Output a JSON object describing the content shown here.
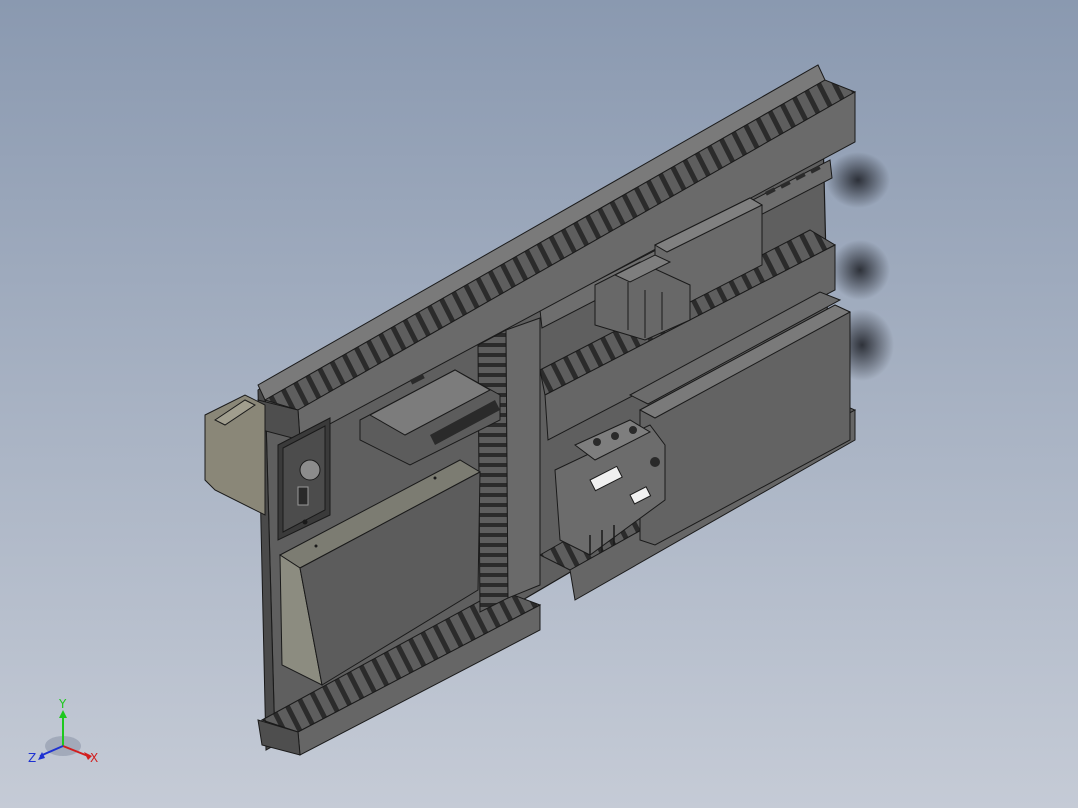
{
  "viewport": {
    "background_top": "#8a99b0",
    "background_bottom": "#c5cbd6"
  },
  "model": {
    "body_color": "#646464",
    "body_light": "#7a7a7a",
    "body_dark": "#4a4a4a",
    "edge_color": "#1a1a1a",
    "accent_white": "#f0f0f0",
    "transformer_color": "#8a8778",
    "psu_color": "#8c8c80"
  },
  "triad": {
    "x_label": "X",
    "y_label": "Y",
    "z_label": "Z",
    "x_color": "#d21e1e",
    "y_color": "#1ec81e",
    "z_color": "#1e32d2"
  }
}
